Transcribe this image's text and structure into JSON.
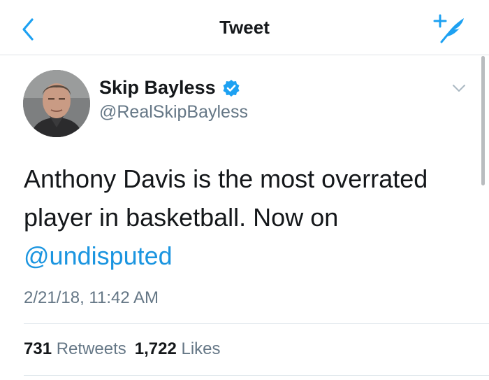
{
  "nav": {
    "title": "Tweet",
    "back_icon": "chevron-left-icon",
    "compose_icon": "compose-tweet-icon",
    "accent_color": "#1da1f2"
  },
  "tweet": {
    "author_name": "Skip Bayless",
    "verified": true,
    "handle": "@RealSkipBayless",
    "text_part1": "Anthony Davis is the most overrated player in basketball. Now on ",
    "mention": "@undisputed",
    "timestamp": "2/21/18, 11:42 AM",
    "retweets_count": "731",
    "retweets_label": "Retweets",
    "likes_count": "1,722",
    "likes_label": "Likes"
  },
  "colors": {
    "link": "#1b95e0",
    "secondary_text": "#657786",
    "primary_text": "#14171a"
  }
}
